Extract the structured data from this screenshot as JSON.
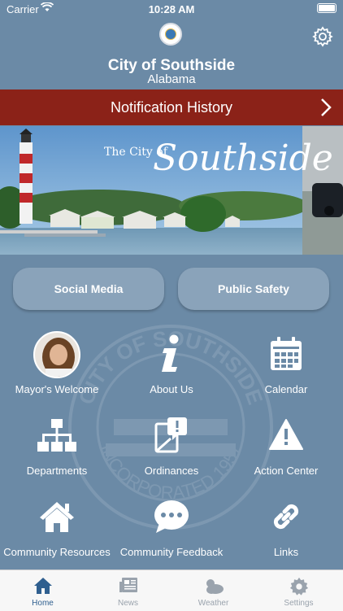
{
  "status": {
    "carrier": "Carrier",
    "time": "10:28 AM"
  },
  "header": {
    "city": "City of Southside",
    "state": "Alabama"
  },
  "notification": {
    "label": "Notification History"
  },
  "hero": {
    "caption_small": "The City of",
    "caption_script": "Southside"
  },
  "buttons": {
    "social": "Social Media",
    "safety": "Public Safety"
  },
  "grid": [
    {
      "label": "Mayor's Welcome",
      "icon": "mayor-photo"
    },
    {
      "label": "About Us",
      "icon": "info-icon"
    },
    {
      "label": "Calendar",
      "icon": "calendar-icon"
    },
    {
      "label": "Departments",
      "icon": "org-chart-icon"
    },
    {
      "label": "Ordinances",
      "icon": "document-alert-icon"
    },
    {
      "label": "Action Center",
      "icon": "warning-icon"
    },
    {
      "label": "Community Resources",
      "icon": "home-icon"
    },
    {
      "label": "Community Feedback",
      "icon": "chat-icon"
    },
    {
      "label": "Links",
      "icon": "link-icon"
    }
  ],
  "tabs": [
    {
      "label": "Home",
      "active": true
    },
    {
      "label": "News",
      "active": false
    },
    {
      "label": "Weather",
      "active": false
    },
    {
      "label": "Settings",
      "active": false
    }
  ],
  "watermark_text": {
    "top": "CITY OF SOUTHSIDE",
    "bottom": "INCORPORATED 1957"
  },
  "colors": {
    "background": "#6b8aa6",
    "banner": "#8b2218",
    "active_tab": "#2f5f8f"
  }
}
